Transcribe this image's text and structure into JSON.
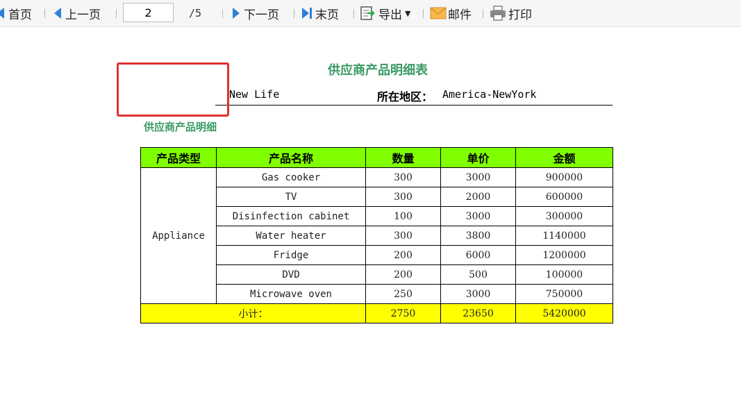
{
  "toolbar": {
    "first_label": "首页",
    "prev_label": "上一页",
    "current_page": "2",
    "total_pages": "/5",
    "next_label": "下一页",
    "last_label": "末页",
    "export_label": "导出",
    "mail_label": "邮件",
    "print_label": "打印"
  },
  "report": {
    "title": "供应商产品明细表",
    "supplier_name": "New Life",
    "region_label": "所在地区：",
    "region_value": "America-NewYork",
    "section_title": "供应商产品明细"
  },
  "table": {
    "headers": [
      "产品类型",
      "产品名称",
      "数量",
      "单价",
      "金额"
    ],
    "category": "Appliance",
    "rows": [
      {
        "name": "Gas cooker",
        "qty": "300",
        "price": "3000",
        "amount": "900000"
      },
      {
        "name": "TV",
        "qty": "300",
        "price": "2000",
        "amount": "600000"
      },
      {
        "name": "Disinfection cabinet",
        "qty": "100",
        "price": "3000",
        "amount": "300000"
      },
      {
        "name": "Water heater",
        "qty": "300",
        "price": "3800",
        "amount": "1140000"
      },
      {
        "name": "Fridge",
        "qty": "200",
        "price": "6000",
        "amount": "1200000"
      },
      {
        "name": "DVD",
        "qty": "200",
        "price": "500",
        "amount": "100000"
      },
      {
        "name": "Microwave oven",
        "qty": "250",
        "price": "3000",
        "amount": "750000"
      }
    ],
    "subtotal": {
      "label": "小计：",
      "qty": "2750",
      "price": "23650",
      "amount": "5420000"
    }
  },
  "colors": {
    "header_bg": "#80ff00",
    "subtotal_bg": "#ffff00",
    "title_green": "#3a9a63",
    "highlight_red": "#e03030",
    "nav_blue": "#2f7fd9"
  }
}
